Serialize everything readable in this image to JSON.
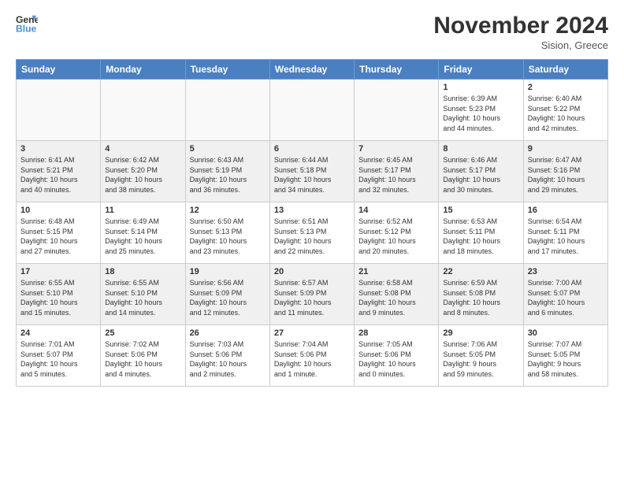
{
  "header": {
    "logo_line1": "General",
    "logo_line2": "Blue",
    "month_title": "November 2024",
    "location": "Sision, Greece"
  },
  "weekdays": [
    "Sunday",
    "Monday",
    "Tuesday",
    "Wednesday",
    "Thursday",
    "Friday",
    "Saturday"
  ],
  "weeks": [
    [
      {
        "day": "",
        "info": ""
      },
      {
        "day": "",
        "info": ""
      },
      {
        "day": "",
        "info": ""
      },
      {
        "day": "",
        "info": ""
      },
      {
        "day": "",
        "info": ""
      },
      {
        "day": "1",
        "info": "Sunrise: 6:39 AM\nSunset: 5:23 PM\nDaylight: 10 hours\nand 44 minutes."
      },
      {
        "day": "2",
        "info": "Sunrise: 6:40 AM\nSunset: 5:22 PM\nDaylight: 10 hours\nand 42 minutes."
      }
    ],
    [
      {
        "day": "3",
        "info": "Sunrise: 6:41 AM\nSunset: 5:21 PM\nDaylight: 10 hours\nand 40 minutes."
      },
      {
        "day": "4",
        "info": "Sunrise: 6:42 AM\nSunset: 5:20 PM\nDaylight: 10 hours\nand 38 minutes."
      },
      {
        "day": "5",
        "info": "Sunrise: 6:43 AM\nSunset: 5:19 PM\nDaylight: 10 hours\nand 36 minutes."
      },
      {
        "day": "6",
        "info": "Sunrise: 6:44 AM\nSunset: 5:18 PM\nDaylight: 10 hours\nand 34 minutes."
      },
      {
        "day": "7",
        "info": "Sunrise: 6:45 AM\nSunset: 5:17 PM\nDaylight: 10 hours\nand 32 minutes."
      },
      {
        "day": "8",
        "info": "Sunrise: 6:46 AM\nSunset: 5:17 PM\nDaylight: 10 hours\nand 30 minutes."
      },
      {
        "day": "9",
        "info": "Sunrise: 6:47 AM\nSunset: 5:16 PM\nDaylight: 10 hours\nand 29 minutes."
      }
    ],
    [
      {
        "day": "10",
        "info": "Sunrise: 6:48 AM\nSunset: 5:15 PM\nDaylight: 10 hours\nand 27 minutes."
      },
      {
        "day": "11",
        "info": "Sunrise: 6:49 AM\nSunset: 5:14 PM\nDaylight: 10 hours\nand 25 minutes."
      },
      {
        "day": "12",
        "info": "Sunrise: 6:50 AM\nSunset: 5:13 PM\nDaylight: 10 hours\nand 23 minutes."
      },
      {
        "day": "13",
        "info": "Sunrise: 6:51 AM\nSunset: 5:13 PM\nDaylight: 10 hours\nand 22 minutes."
      },
      {
        "day": "14",
        "info": "Sunrise: 6:52 AM\nSunset: 5:12 PM\nDaylight: 10 hours\nand 20 minutes."
      },
      {
        "day": "15",
        "info": "Sunrise: 6:53 AM\nSunset: 5:11 PM\nDaylight: 10 hours\nand 18 minutes."
      },
      {
        "day": "16",
        "info": "Sunrise: 6:54 AM\nSunset: 5:11 PM\nDaylight: 10 hours\nand 17 minutes."
      }
    ],
    [
      {
        "day": "17",
        "info": "Sunrise: 6:55 AM\nSunset: 5:10 PM\nDaylight: 10 hours\nand 15 minutes."
      },
      {
        "day": "18",
        "info": "Sunrise: 6:55 AM\nSunset: 5:10 PM\nDaylight: 10 hours\nand 14 minutes."
      },
      {
        "day": "19",
        "info": "Sunrise: 6:56 AM\nSunset: 5:09 PM\nDaylight: 10 hours\nand 12 minutes."
      },
      {
        "day": "20",
        "info": "Sunrise: 6:57 AM\nSunset: 5:09 PM\nDaylight: 10 hours\nand 11 minutes."
      },
      {
        "day": "21",
        "info": "Sunrise: 6:58 AM\nSunset: 5:08 PM\nDaylight: 10 hours\nand 9 minutes."
      },
      {
        "day": "22",
        "info": "Sunrise: 6:59 AM\nSunset: 5:08 PM\nDaylight: 10 hours\nand 8 minutes."
      },
      {
        "day": "23",
        "info": "Sunrise: 7:00 AM\nSunset: 5:07 PM\nDaylight: 10 hours\nand 6 minutes."
      }
    ],
    [
      {
        "day": "24",
        "info": "Sunrise: 7:01 AM\nSunset: 5:07 PM\nDaylight: 10 hours\nand 5 minutes."
      },
      {
        "day": "25",
        "info": "Sunrise: 7:02 AM\nSunset: 5:06 PM\nDaylight: 10 hours\nand 4 minutes."
      },
      {
        "day": "26",
        "info": "Sunrise: 7:03 AM\nSunset: 5:06 PM\nDaylight: 10 hours\nand 2 minutes."
      },
      {
        "day": "27",
        "info": "Sunrise: 7:04 AM\nSunset: 5:06 PM\nDaylight: 10 hours\nand 1 minute."
      },
      {
        "day": "28",
        "info": "Sunrise: 7:05 AM\nSunset: 5:06 PM\nDaylight: 10 hours\nand 0 minutes."
      },
      {
        "day": "29",
        "info": "Sunrise: 7:06 AM\nSunset: 5:05 PM\nDaylight: 9 hours\nand 59 minutes."
      },
      {
        "day": "30",
        "info": "Sunrise: 7:07 AM\nSunset: 5:05 PM\nDaylight: 9 hours\nand 58 minutes."
      }
    ]
  ]
}
